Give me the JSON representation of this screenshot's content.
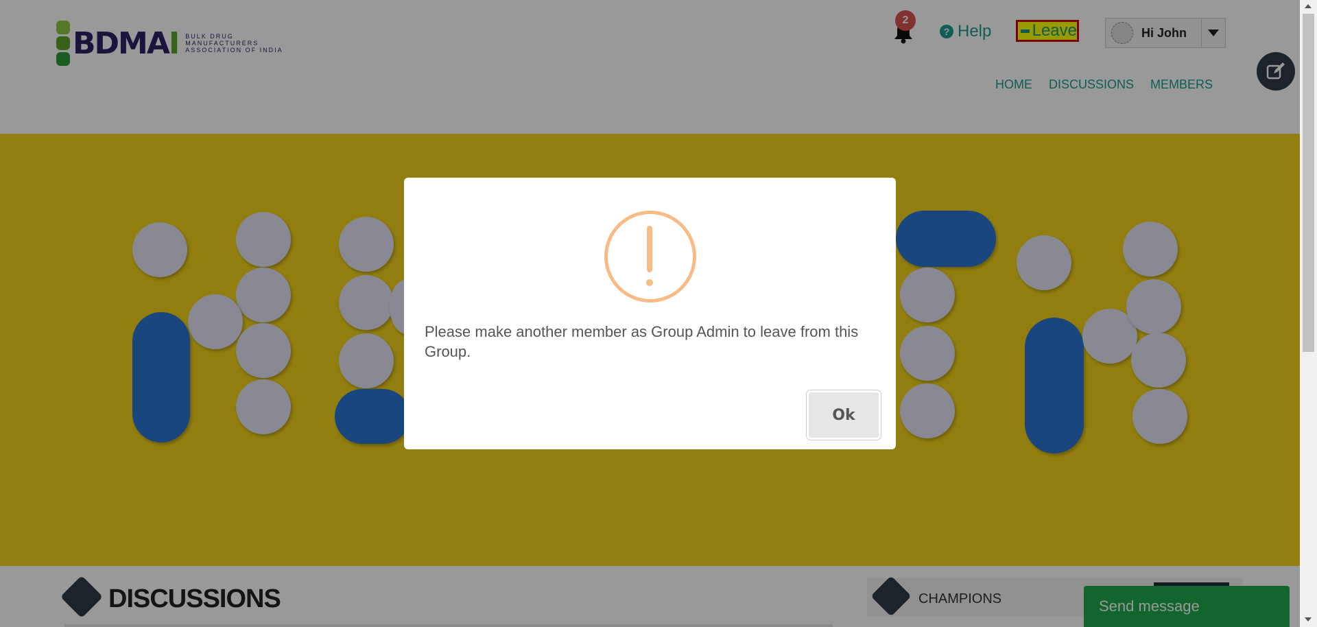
{
  "header": {
    "logo_text": "BDMA",
    "logo_text_end": "I",
    "logo_subtitle_lines": [
      "BULK DRUG",
      "MANUFACTURERS",
      "ASSOCIATION OF INDIA"
    ],
    "notification_count": "2",
    "help_label": "Help",
    "leave_label": "Leave",
    "user_greeting": "Hi John"
  },
  "nav": {
    "items": [
      "HOME",
      "DISCUSSIONS",
      "MEMBERS"
    ]
  },
  "banner": {
    "background_color": "#f2d31a",
    "pill_color": "#e4e4f5",
    "capsule_color": "#2b76d4"
  },
  "sections": {
    "discussions_title": "DISCUSSIONS",
    "champions_title": "CHAMPIONS"
  },
  "chat": {
    "send_message_label": "Send message"
  },
  "modal": {
    "message": "Please make another member as Group Admin to leave from this Group.",
    "ok_label": "Ok",
    "icon": "warning-icon",
    "icon_color": "#f8bb86"
  },
  "colors": {
    "accent": "#1a9c8c",
    "badge": "#d9534f",
    "send_button": "#1fa84a",
    "dark": "#2f3b46"
  }
}
